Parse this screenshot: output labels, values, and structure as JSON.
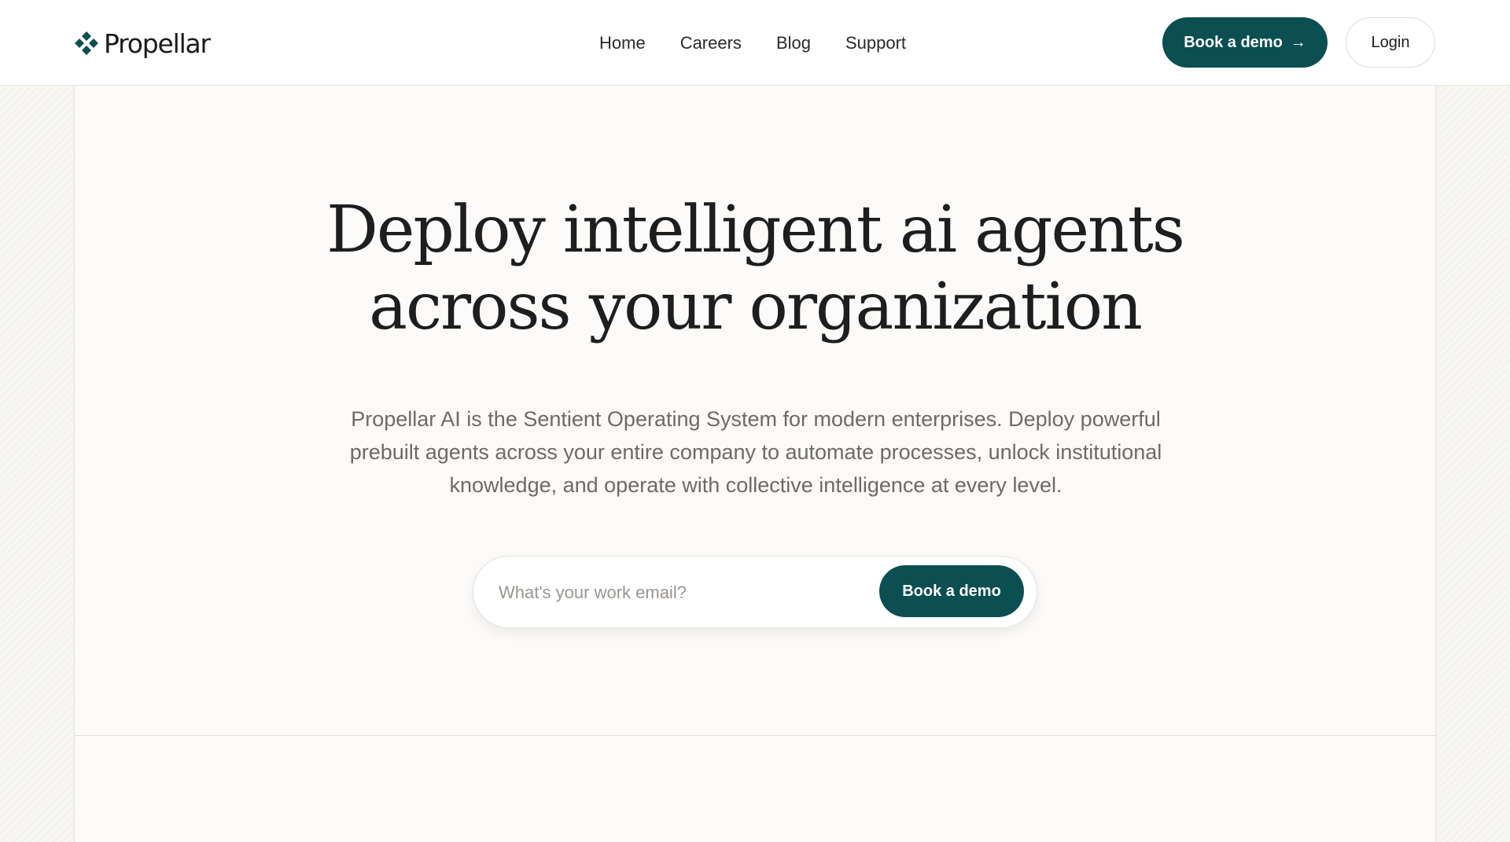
{
  "brand": {
    "name": "Propellar",
    "icon": "logo-icon"
  },
  "nav": {
    "items": [
      {
        "label": "Home"
      },
      {
        "label": "Careers"
      },
      {
        "label": "Blog"
      },
      {
        "label": "Support"
      }
    ]
  },
  "header_actions": {
    "demo_label": "Book a demo",
    "demo_icon": "arrow-right-icon",
    "login_label": "Login"
  },
  "hero": {
    "title_line1": "Deploy intelligent ai agents",
    "title_line2": "across your organization",
    "description": "Propellar AI is the Sentient Operating System for modern enterprises. Deploy powerful prebuilt agents across your entire company to automate processes, unlock institutional knowledge, and operate with collective intelligence at every level."
  },
  "signup": {
    "email_placeholder": "What's your work email?",
    "email_value": "",
    "button_label": "Book a demo"
  },
  "colors": {
    "accent": "#0b4f52",
    "page_background": "#fcfbf9",
    "text": "#1e1e1e",
    "muted_text": "#6d6a66"
  }
}
